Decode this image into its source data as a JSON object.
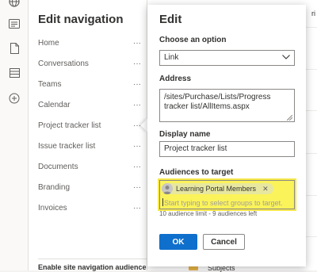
{
  "rail": {
    "icons": [
      "globe-icon",
      "news-icon",
      "document-icon",
      "list-icon",
      "add-icon"
    ]
  },
  "nav": {
    "title": "Edit navigation",
    "more_glyph": "···",
    "items": [
      {
        "label": "Home"
      },
      {
        "label": "Conversations"
      },
      {
        "label": "Teams"
      },
      {
        "label": "Calendar"
      },
      {
        "label": "Project tracker list"
      },
      {
        "label": "Issue tracker list"
      },
      {
        "label": "Documents"
      },
      {
        "label": "Branding"
      },
      {
        "label": "Invoices"
      }
    ],
    "footer": "Enable site navigation audience"
  },
  "background": {
    "header_fragment": "ri",
    "row_fragment": "Subjects"
  },
  "dialog": {
    "title": "Edit",
    "option": {
      "label": "Choose an option",
      "value": "Link"
    },
    "address": {
      "label": "Address",
      "value": "/sites/Purchase/Lists/Progress tracker list/AllItems.aspx"
    },
    "display_name": {
      "label": "Display name",
      "value": "Project tracker list"
    },
    "audiences": {
      "label": "Audiences to target",
      "selected": "Learning Portal Members",
      "placeholder": "Start typing to select groups to target.",
      "hint": "10 audience limit - 9 audiences left"
    },
    "ok_label": "OK",
    "cancel_label": "Cancel"
  },
  "colors": {
    "ok_button": "#0f6fcc",
    "highlight": "#fbf35a"
  }
}
